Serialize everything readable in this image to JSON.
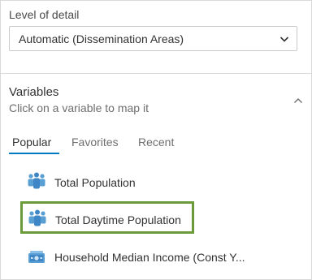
{
  "level_of_detail": {
    "label": "Level of detail",
    "selected": "Automatic (Dissemination Areas)",
    "chevron_icon": "chevron-down-icon"
  },
  "variables": {
    "title": "Variables",
    "subtitle": "Click on a variable to map it",
    "collapse_icon": "chevron-up-icon",
    "tabs": [
      {
        "label": "Popular",
        "active": true
      },
      {
        "label": "Favorites",
        "active": false
      },
      {
        "label": "Recent",
        "active": false
      }
    ],
    "items": [
      {
        "label": "Total Population",
        "icon": "population-icon"
      },
      {
        "label": "Total Daytime Population",
        "icon": "population-icon",
        "highlighted": true
      },
      {
        "label": "Household Median Income (Const Y...",
        "icon": "income-icon"
      }
    ]
  },
  "colors": {
    "accent": "#007ac2",
    "highlight_border": "#6b9a3a",
    "icon_blue": "#5a9fd4"
  }
}
